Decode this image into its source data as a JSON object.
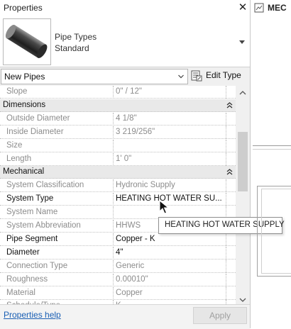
{
  "palette": {
    "title": "Properties",
    "close_glyph": "✕",
    "type_selector": {
      "family": "Pipe Types",
      "type": "Standard",
      "thumbnail_icon": "pipe-icon",
      "dropdown_icon": "caret-down-icon"
    },
    "filter": {
      "selected": "New Pipes",
      "dropdown_icon": "chevron-down-icon"
    },
    "edit_type": {
      "label": "Edit Type",
      "icon": "edit-type-icon"
    },
    "rows": [
      {
        "kind": "prop",
        "name": "Slope",
        "value": "0\" / 12\"",
        "editable": false
      },
      {
        "kind": "group",
        "name": "Dimensions"
      },
      {
        "kind": "prop",
        "name": "Outside Diameter",
        "value": "4 1/8\"",
        "editable": false
      },
      {
        "kind": "prop",
        "name": "Inside Diameter",
        "value": "3 219/256\"",
        "editable": false
      },
      {
        "kind": "prop",
        "name": "Size",
        "value": "",
        "editable": false
      },
      {
        "kind": "prop",
        "name": "Length",
        "value": "1' 0\"",
        "editable": false
      },
      {
        "kind": "group",
        "name": "Mechanical"
      },
      {
        "kind": "prop",
        "name": "System Classification",
        "value": "Hydronic Supply",
        "editable": false
      },
      {
        "kind": "prop",
        "name": "System Type",
        "value": "HEATING HOT WATER SU...",
        "editable": true
      },
      {
        "kind": "prop",
        "name": "System Name",
        "value": "",
        "editable": false
      },
      {
        "kind": "prop",
        "name": "System Abbreviation",
        "value": "HHWS",
        "editable": false
      },
      {
        "kind": "prop",
        "name": "Pipe Segment",
        "value": "Copper - K",
        "editable": true
      },
      {
        "kind": "prop",
        "name": "Diameter",
        "value": "4\"",
        "editable": true
      },
      {
        "kind": "prop",
        "name": "Connection Type",
        "value": "Generic",
        "editable": false
      },
      {
        "kind": "prop",
        "name": "Roughness",
        "value": "0.00010\"",
        "editable": false
      },
      {
        "kind": "prop",
        "name": "Material",
        "value": "Copper",
        "editable": false
      },
      {
        "kind": "prop",
        "name": "Schedule/Type",
        "value": "K",
        "editable": false
      }
    ],
    "tooltip": "HEATING HOT WATER SUPPLY",
    "help_link": "Properties help",
    "apply_label": "Apply"
  },
  "view": {
    "tab_label": "MEC",
    "tab_icon": "view-tab-icon"
  },
  "colors": {
    "group_bg": "#e9e9e9",
    "readonly_text": "#8c8c8c",
    "link": "#1a5fb4"
  }
}
